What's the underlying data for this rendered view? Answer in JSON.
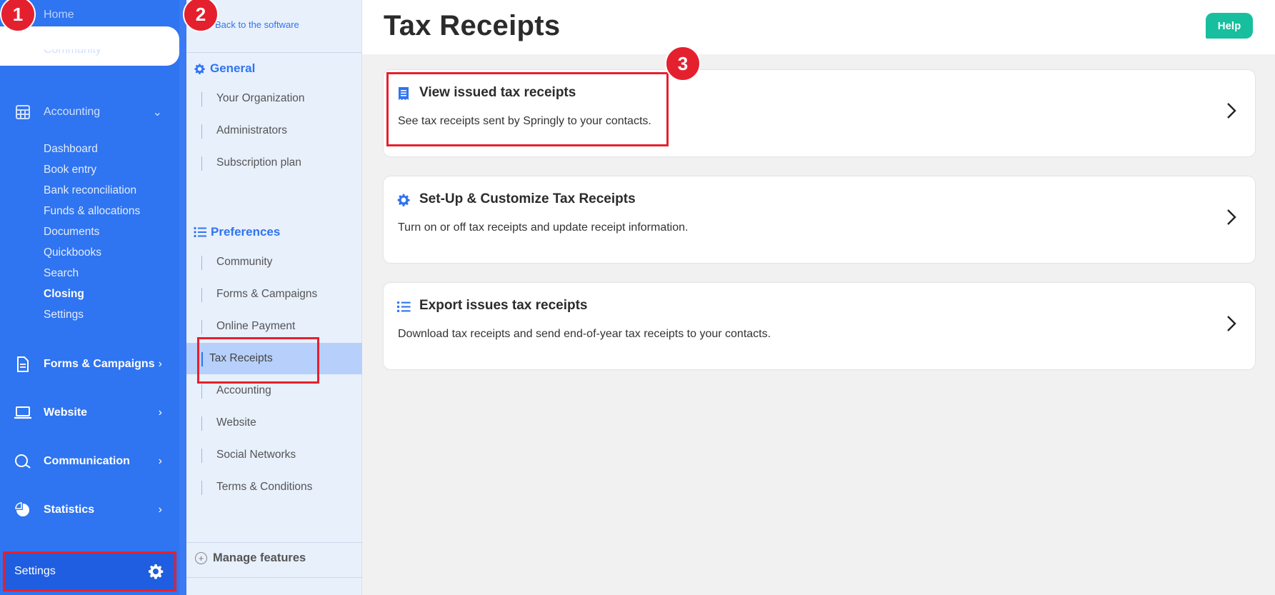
{
  "nav": {
    "home": "Home",
    "community": "Community",
    "accounting": "Accounting",
    "accounting_sub": [
      "Dashboard",
      "Book entry",
      "Bank reconciliation",
      "Funds & allocations",
      "Documents",
      "Quickbooks",
      "Search",
      "Closing",
      "Settings"
    ],
    "forms_campaigns": "Forms & Campaigns",
    "website": "Website",
    "communication": "Communication",
    "statistics": "Statistics",
    "settings": "Settings"
  },
  "menu": {
    "back": "Back to the software",
    "general": "General",
    "general_items": [
      "Your Organization",
      "Administrators",
      "Subscription plan"
    ],
    "preferences": "Preferences",
    "preferences_items": [
      "Community",
      "Forms & Campaigns",
      "Online Payment",
      "Tax Receipts",
      "Accounting",
      "Website",
      "Social Networks",
      "Terms & Conditions"
    ],
    "manage_features": "Manage features"
  },
  "page": {
    "title": "Tax Receipts",
    "help": "Help"
  },
  "cards": [
    {
      "title": "View issued tax receipts",
      "desc": "See tax receipts sent by Springly to your contacts.",
      "icon": "receipt-icon"
    },
    {
      "title": "Set-Up & Customize Tax Receipts",
      "desc": "Turn on or off tax receipts and update receipt information.",
      "icon": "gear-icon"
    },
    {
      "title": "Export issues tax receipts",
      "desc": "Download tax receipts and send end-of-year tax receipts to your contacts.",
      "icon": "list-icon"
    }
  ],
  "badges": [
    "1",
    "2",
    "3"
  ],
  "colors": {
    "primary": "#2f74f0",
    "help": "#17bf9e",
    "highlight": "#e5202e",
    "active_menu": "#b7d0fb"
  }
}
